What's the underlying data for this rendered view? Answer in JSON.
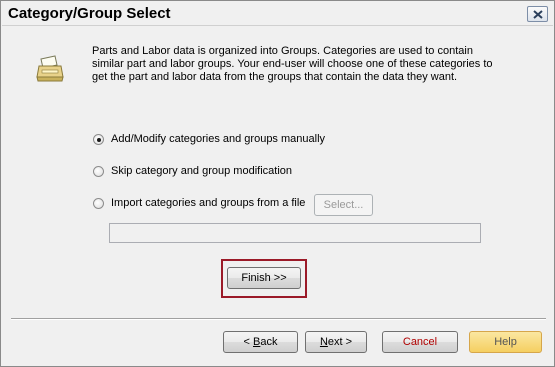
{
  "window": {
    "title": "Category/Group Select"
  },
  "description": {
    "lines": [
      "Parts and Labor data is organized into Groups.  Categories are used to contain",
      "similar part and labor groups.  Your end-user will choose one of these categories to",
      "get the part and labor data from the groups that contain the data they want."
    ]
  },
  "options": {
    "manual": {
      "label": "Add/Modify categories and groups manually",
      "checked": true
    },
    "skip": {
      "label": "Skip category and group modification",
      "checked": false
    },
    "import": {
      "label": "Import categories and groups from a file",
      "checked": false
    }
  },
  "select_button": {
    "label": "Select..."
  },
  "file_path": {
    "value": ""
  },
  "finish_button": {
    "label": "Finish >>"
  },
  "nav": {
    "back_prefix": "< ",
    "back_accel": "B",
    "back_rest": "ack",
    "next_accel": "N",
    "next_rest": "ext >",
    "cancel": "Cancel",
    "help": "Help"
  },
  "colors": {
    "highlight_border": "#9b1a28",
    "help_button": "#f5cf61",
    "cancel_text": "#b00000"
  },
  "icons": {
    "header": "printer-folder-icon",
    "close": "close-icon"
  }
}
